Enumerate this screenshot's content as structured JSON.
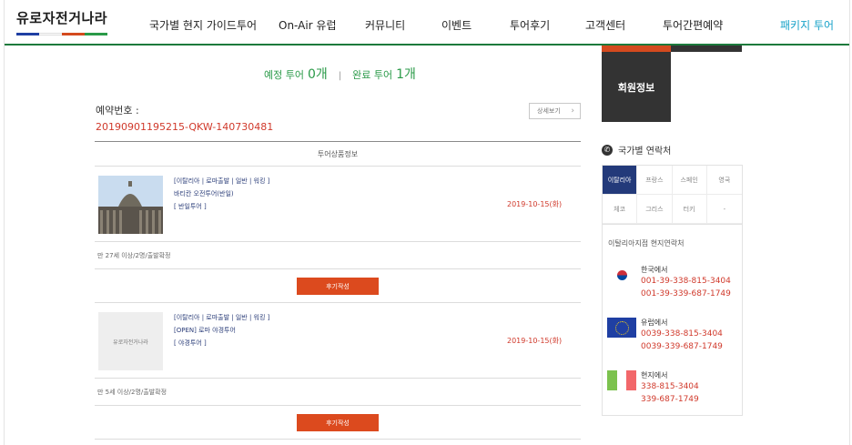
{
  "header": {
    "logo_text": "유로자전거나라",
    "nav": [
      {
        "label": "국가별 현지 가이드투어"
      },
      {
        "label": "On-Air 유럽"
      },
      {
        "label": "커뮤니티"
      },
      {
        "label": "이벤트"
      },
      {
        "label": "투어후기"
      },
      {
        "label": "고객센터"
      },
      {
        "label": "투어간편예약"
      },
      {
        "label": "패키지 투어"
      }
    ]
  },
  "tour_count": {
    "scheduled_label": "예정 투어",
    "scheduled_count": "0개",
    "separator": "|",
    "completed_label": "완료 투어",
    "completed_count": "1개"
  },
  "reservation": {
    "label": "예약번호 :",
    "number": "20190901195215-QKW-140730481",
    "detail_button": "상세보기",
    "section_title": "투어상품정보"
  },
  "tours": [
    {
      "tags": "[이탈리아 | 로마출발 | 일반 | 워킹 ]",
      "name": "바티칸 오전투어(반일)",
      "type": "[ 반일투어 ]",
      "date": "2019-10-15(화)",
      "people": "만 27세 이상/2명/출발확정",
      "review_button": "후기작성",
      "thumb": "photo"
    },
    {
      "tags": "[이탈리아 | 로마출발 | 일반 | 워킹 ]",
      "name": "[OPEN] 로마 야경투어",
      "type": "[ 야경투어 ]",
      "date": "2019-10-15(화)",
      "people": "만 5세 이상/2명/출발확정",
      "review_button": "후기작성",
      "thumb": "logo",
      "thumb_logo_text": "유로자전거나라"
    }
  ],
  "sidebar": {
    "member_label": "회원정보",
    "contact_title": "국가별 연락처",
    "countries": [
      "이탈리아",
      "프랑스",
      "스페인",
      "영국",
      "체코",
      "그리스",
      "터키",
      "-"
    ],
    "active_country": "이탈리아",
    "branch_title": "이탈리아지점 현지연락처",
    "contacts": [
      {
        "label": "한국에서",
        "phones": [
          "001-39-338-815-3404",
          "001-39-339-687-1749"
        ],
        "flag": "korea-flag"
      },
      {
        "label": "유럽에서",
        "phones": [
          "0039-338-815-3404",
          "0039-339-687-1749"
        ],
        "flag": "eu-flag"
      },
      {
        "label": "현지에서",
        "phones": [
          "338-815-3404",
          "339-687-1749"
        ],
        "flag": "italy-flag"
      }
    ]
  },
  "colors": {
    "brand_green": "#1b7a3c",
    "accent_red": "#d0392b",
    "review_orange": "#dc4a1e",
    "active_country_bg": "#233a7a",
    "package_blue": "#1aa3c9"
  }
}
